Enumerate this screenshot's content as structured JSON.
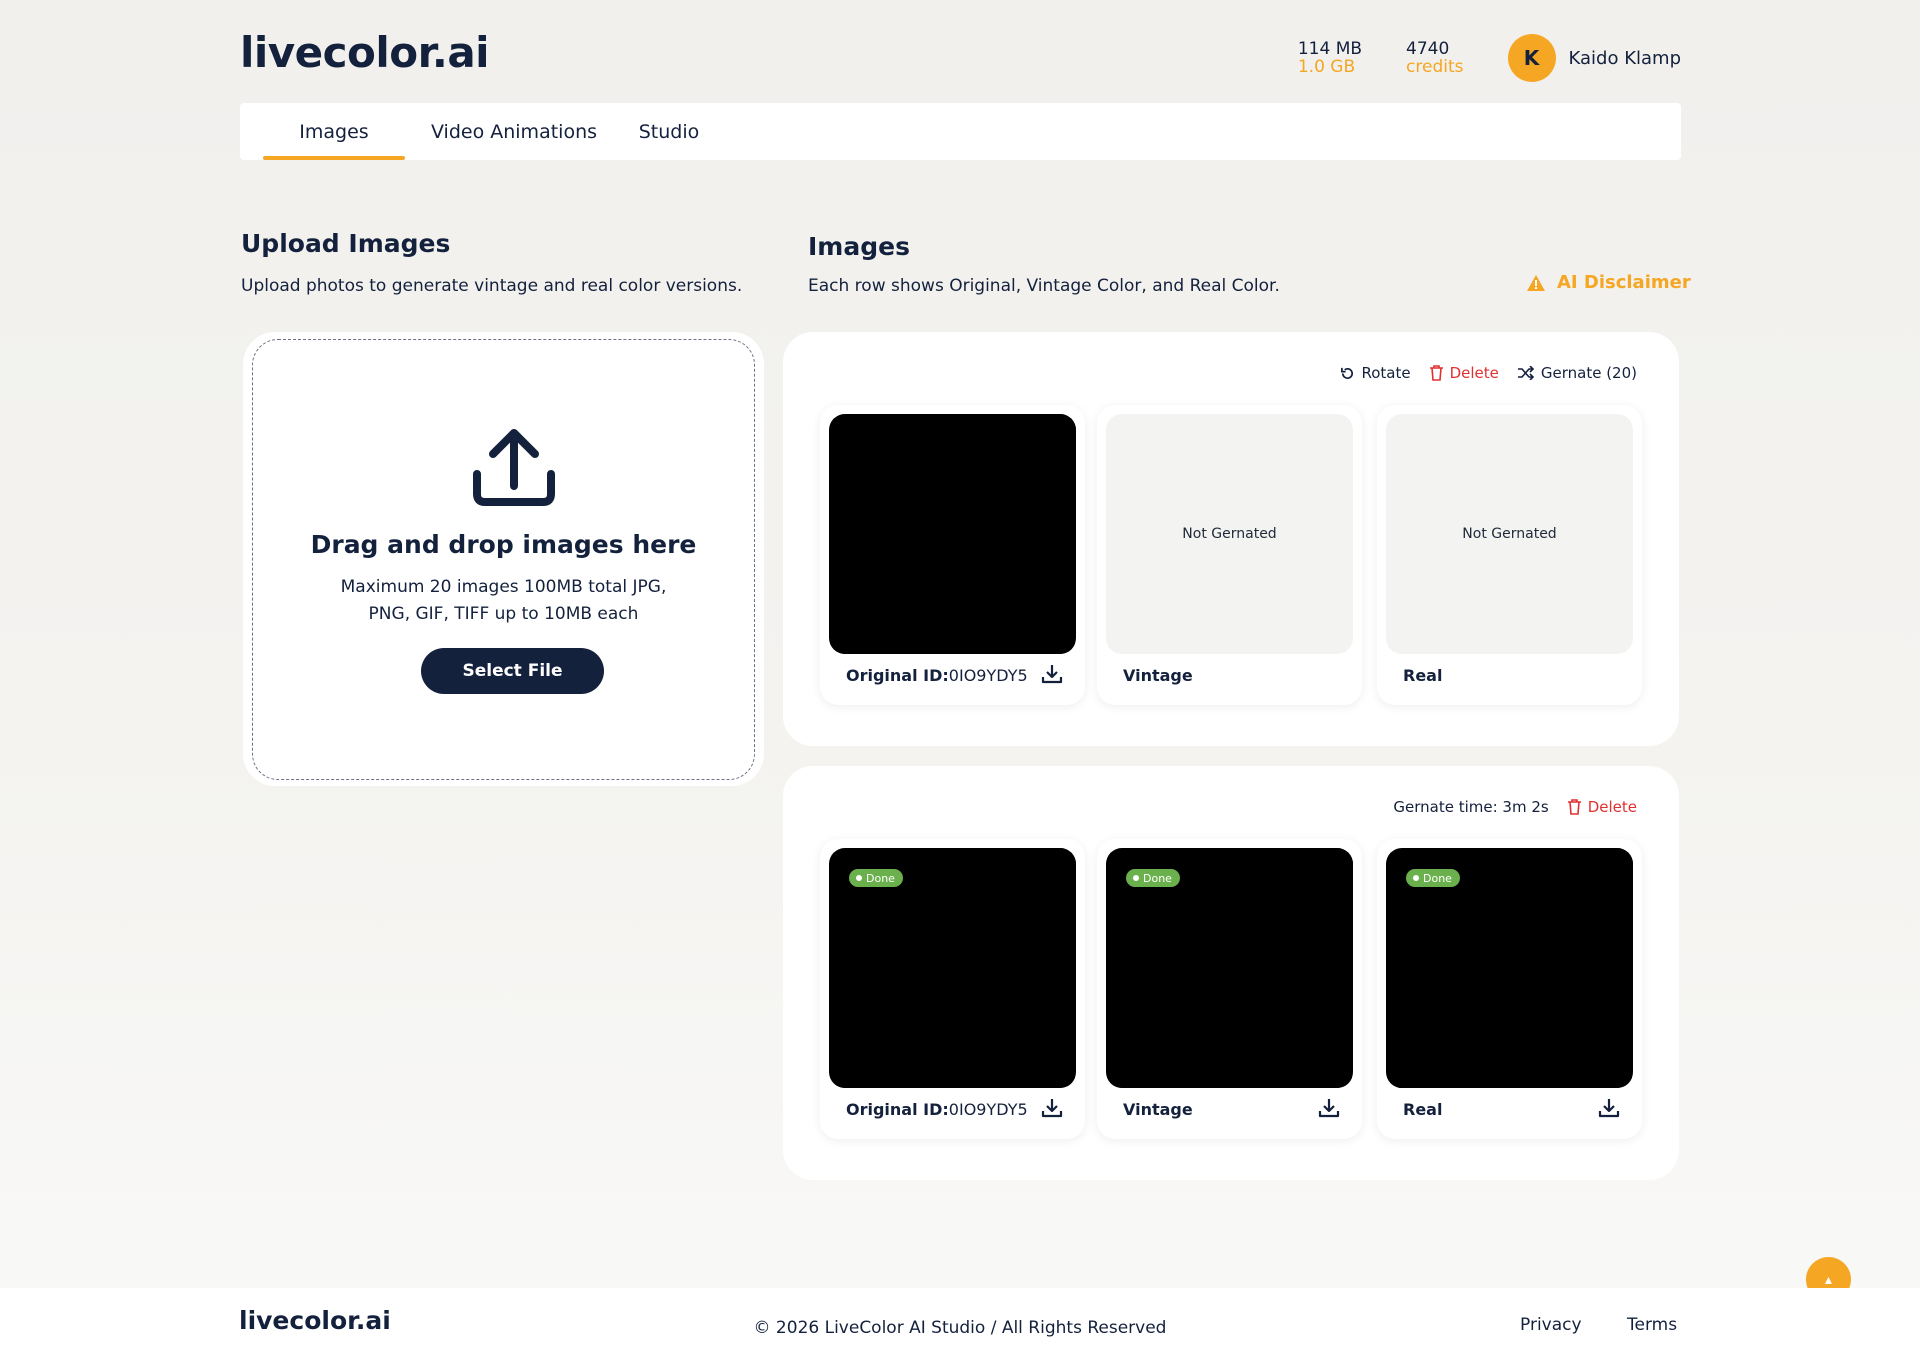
{
  "app": {
    "logo": "livecolor.ai"
  },
  "header": {
    "storage_used": "114 MB",
    "storage_total": "1.0 GB",
    "credits_value": "4740",
    "credits_label": "credits",
    "avatar_initial": "K",
    "user_name": "Kaido Klamp"
  },
  "tabs": [
    {
      "label": "Images",
      "active": true
    },
    {
      "label": "Video Animations",
      "active": false
    },
    {
      "label": "Studio",
      "active": false
    }
  ],
  "upload": {
    "title": "Upload Images",
    "subtitle": "Upload photos to generate vintage and real color versions.",
    "drop_title": "Drag and drop images here",
    "drop_text": "Maximum 20 images 100MB total JPG, PNG, GIF, TIFF up to 10MB each",
    "button": "Select File"
  },
  "images": {
    "title": "Images",
    "subtitle": "Each row shows Original, Vintage Color, and Real Color.",
    "disclaimer": "AI Disclaimer",
    "rows": [
      {
        "actions": {
          "rotate": "Rotate",
          "delete": "Delete",
          "generate": "Gernate (20)"
        },
        "original_label": "Original ID:",
        "original_id": "0IO9YDY5",
        "vintage_label": "Vintage",
        "vintage_status": "Not Gernated",
        "real_label": "Real",
        "real_status": "Not Gernated"
      },
      {
        "generate_time": "Gernate time: 3m 2s",
        "actions": {
          "delete": "Delete"
        },
        "original_label": "Original ID:",
        "original_id": "0IO9YDY5",
        "vintage_label": "Vintage",
        "real_label": "Real",
        "badge": "Done"
      }
    ]
  },
  "footer": {
    "logo": "livecolor.ai",
    "copyright": "© 2026 LiveColor AI Studio / All Rights Reserved",
    "privacy": "Privacy",
    "terms": "Terms"
  },
  "colors": {
    "accent": "#f5a623",
    "navy": "#14213d",
    "danger": "#e03131",
    "done": "#6ab04c"
  }
}
